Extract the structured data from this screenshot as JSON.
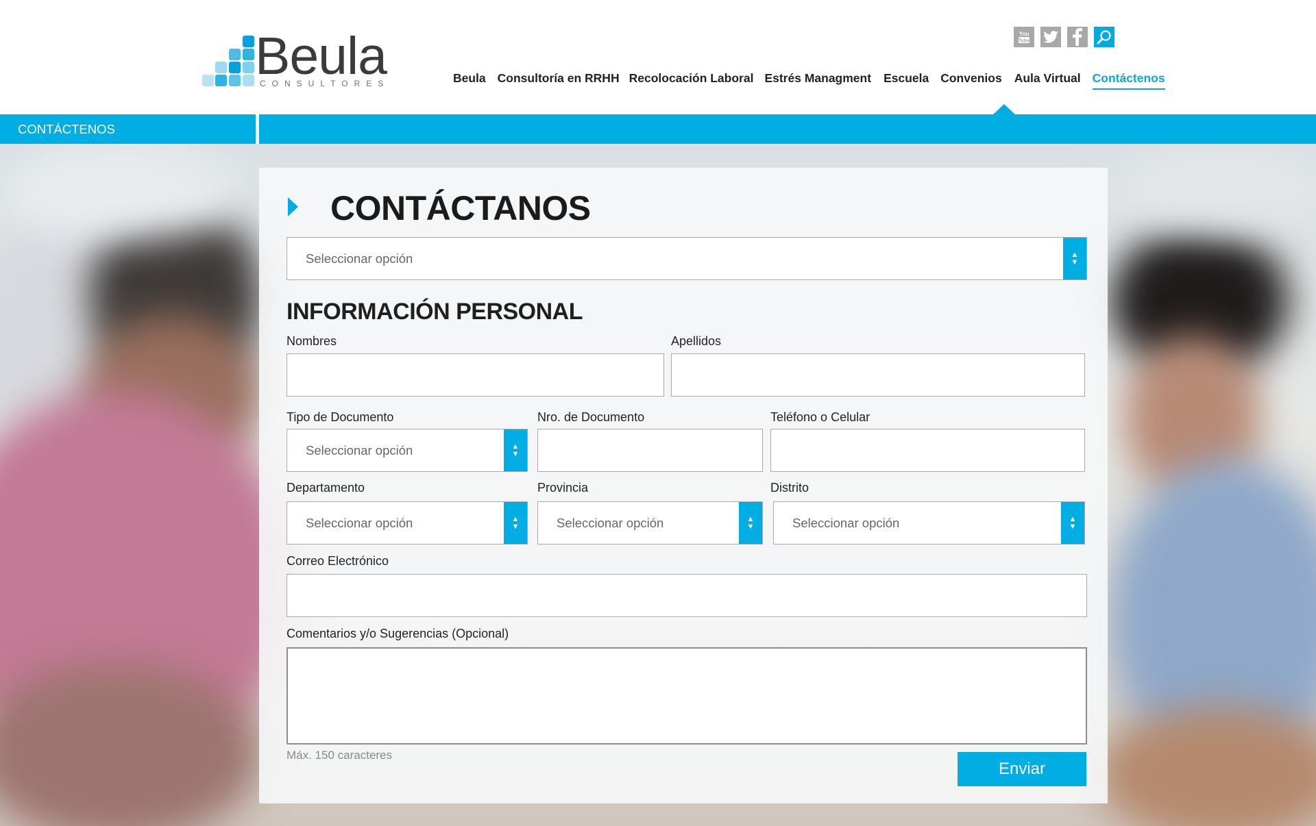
{
  "brand": {
    "name": "Beula",
    "subtitle": "CONSULTORES"
  },
  "social": [
    {
      "icon": "youtube-icon",
      "glyph": "You Tube"
    },
    {
      "icon": "twitter-icon",
      "glyph": "t"
    },
    {
      "icon": "facebook-icon",
      "glyph": "f"
    },
    {
      "icon": "search-icon",
      "glyph": "⌕"
    }
  ],
  "nav": [
    {
      "label": "Beula"
    },
    {
      "label": "Consultoría en RRHH"
    },
    {
      "label": "Recolocación Laboral"
    },
    {
      "label": "Estrés Managment"
    },
    {
      "label": "Escuela"
    },
    {
      "label": "Convenios"
    },
    {
      "label": "Aula Virtual"
    },
    {
      "label": "Contáctenos",
      "active": true
    }
  ],
  "breadcrumb": "CONTÁCTENOS",
  "form": {
    "title": "CONTÁCTANOS",
    "top_select_placeholder": "Seleccionar opción",
    "section_title": "INFORMACIÓN PERSONAL",
    "nombres_label": "Nombres",
    "apellidos_label": "Apellidos",
    "tipo_doc_label": "Tipo de Documento",
    "tipo_doc_placeholder": "Seleccionar opción",
    "nro_doc_label": "Nro. de Documento",
    "telefono_label": "Teléfono o Celular",
    "departamento_label": "Departamento",
    "departamento_placeholder": "Seleccionar opción",
    "provincia_label": "Provincia",
    "provincia_placeholder": "Seleccionar opción",
    "distrito_label": "Distrito",
    "distrito_placeholder": "Seleccionar opción",
    "correo_label": "Correo Electrónico",
    "comentarios_label": "Comentarios y/o Sugerencias (Opcional)",
    "max_hint": "Máx. 150 caracteres",
    "submit_label": "Enviar"
  },
  "colors": {
    "accent": "#00aee4",
    "text": "#1d1d1d",
    "muted": "#8a8a8a"
  }
}
